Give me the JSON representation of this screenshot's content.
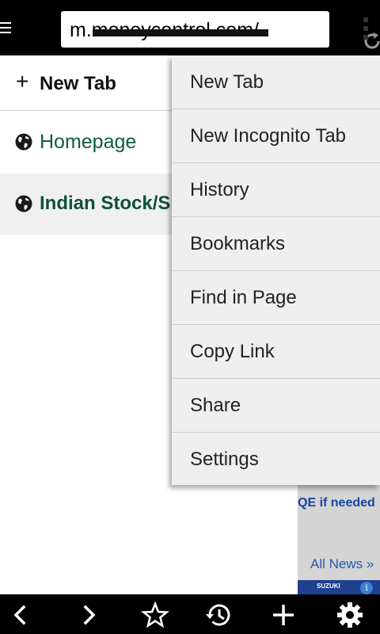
{
  "address_bar": {
    "url_text": "m.moneycontrol.com/"
  },
  "tab_list": {
    "new_tab_label": "New Tab",
    "tabs": [
      {
        "title": "Homepage"
      },
      {
        "title": "Indian Stock/Sh"
      }
    ]
  },
  "popup_menu": {
    "items": [
      {
        "label": "New Tab"
      },
      {
        "label": "New Incognito Tab"
      },
      {
        "label": "History"
      },
      {
        "label": "Bookmarks"
      },
      {
        "label": "Find in Page"
      },
      {
        "label": "Copy Link"
      },
      {
        "label": "Share"
      },
      {
        "label": "Settings"
      }
    ]
  },
  "background_page": {
    "headline_fragment": "QE if needed",
    "all_news_link": "All News »",
    "ad_text": "SUZUKI",
    "info_glyph": "i"
  },
  "icons": {
    "menu": "hamburger-icon",
    "reload": "reload-icon",
    "overflow": "overflow-menu-icon",
    "tab": "globe-icon",
    "back": "chevron-left-icon",
    "forward": "chevron-right-icon",
    "bookmark": "star-icon",
    "history": "history-icon",
    "add": "plus-icon",
    "settings": "gear-icon"
  },
  "colors": {
    "topbar": "#000000",
    "tab_title": "#0f5a4a",
    "menu_background": "#efefef",
    "selected_tab_background": "#f0f0f0"
  }
}
